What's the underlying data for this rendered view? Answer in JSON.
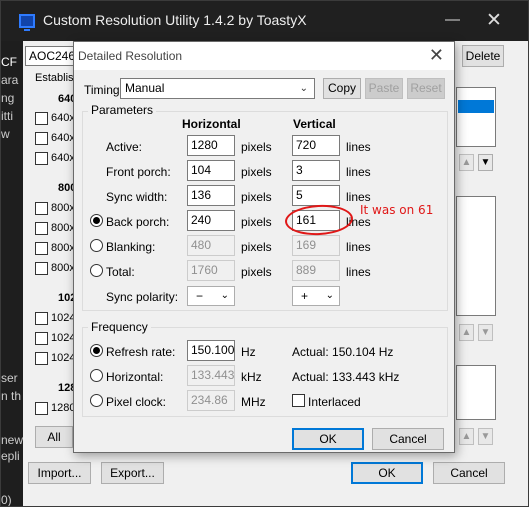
{
  "main_window": {
    "title": "Custom Resolution Utility 1.4.2 by ToastyX",
    "minimize_glyph": "—",
    "close_glyph": "✕",
    "monitor_combo": "AOC246A",
    "delete_label": "Delete",
    "established_label": "Establis",
    "groups": [
      {
        "label": "640",
        "items": [
          "640x",
          "640x",
          "640x"
        ]
      },
      {
        "label": "800",
        "items": [
          "800x",
          "800x",
          "800x",
          "800x"
        ]
      },
      {
        "label": "102",
        "items": [
          "1024",
          "1024",
          "1024"
        ]
      },
      {
        "label": "128",
        "items": [
          "1280"
        ]
      }
    ],
    "all_label": "All",
    "import_label": "Import...",
    "export_label": "Export...",
    "ok_label": "OK",
    "cancel_label": "Cancel",
    "left_fragments": [
      "CF",
      "ara",
      "ng",
      "itti",
      "w",
      "ser",
      "n th",
      "new",
      "epli",
      "0)"
    ]
  },
  "dialog": {
    "title": "Detailed Resolution",
    "close_glyph": "✕",
    "timing_label": "Timing:",
    "timing_value": "Manual",
    "copy_label": "Copy",
    "paste_label": "Paste",
    "reset_label": "Reset",
    "parameters_label": "Parameters",
    "horizontal_header": "Horizontal",
    "vertical_header": "Vertical",
    "h_unit": "pixels",
    "v_unit": "lines",
    "rows": [
      {
        "label": "Active:",
        "h": "1280",
        "v": "720"
      },
      {
        "label": "Front porch:",
        "h": "104",
        "v": "3"
      },
      {
        "label": "Sync width:",
        "h": "136",
        "v": "5"
      },
      {
        "label": "Back porch:",
        "h": "240",
        "v": "161"
      },
      {
        "label": "Blanking:",
        "h": "480",
        "v": "169"
      },
      {
        "label": "Total:",
        "h": "1760",
        "v": "889"
      }
    ],
    "sync_polarity_label": "Sync polarity:",
    "h_polarity": "−",
    "v_polarity": "+",
    "frequency_label": "Frequency",
    "refresh_label": "Refresh rate:",
    "refresh_value": "150.100",
    "refresh_unit": "Hz",
    "refresh_actual": "Actual: 150.104 Hz",
    "horizontal_label": "Horizontal:",
    "horizontal_value": "133.443",
    "horizontal_unit": "kHz",
    "horizontal_actual": "Actual: 133.443 kHz",
    "pixel_clock_label": "Pixel clock:",
    "pixel_clock_value": "234.86",
    "pixel_clock_unit": "MHz",
    "interlaced_label": "Interlaced",
    "ok_label": "OK",
    "cancel_label": "Cancel"
  },
  "annotation": {
    "text": "It was on 61",
    "color": "#e01818"
  }
}
